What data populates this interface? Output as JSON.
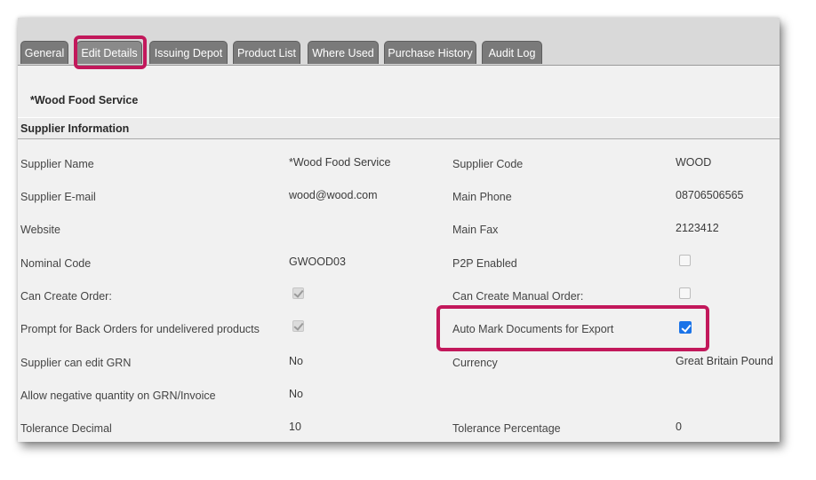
{
  "tabs": [
    {
      "label": "General"
    },
    {
      "label": "Edit Details"
    },
    {
      "label": "Issuing Depot"
    },
    {
      "label": "Product List"
    },
    {
      "label": "Where Used"
    },
    {
      "label": "Purchase History"
    },
    {
      "label": "Audit Log"
    }
  ],
  "active_tab": "Edit Details",
  "company_name": "*Wood Food Service",
  "section_title": "Supplier Information",
  "fields": {
    "supplier_name": {
      "label": "Supplier Name",
      "value": "*Wood Food Service"
    },
    "supplier_code": {
      "label": "Supplier Code",
      "value": "WOOD"
    },
    "supplier_email": {
      "label": "Supplier E-mail",
      "value": "wood@wood.com"
    },
    "main_phone": {
      "label": "Main Phone",
      "value": "08706506565"
    },
    "website": {
      "label": "Website",
      "value": ""
    },
    "main_fax": {
      "label": "Main Fax",
      "value": "2123412"
    },
    "nominal_code": {
      "label": "Nominal Code",
      "value": "GWOOD03"
    },
    "p2p_enabled": {
      "label": "P2P Enabled",
      "checked": false
    },
    "can_create_order": {
      "label": "Can Create Order:",
      "checked": true
    },
    "can_create_manual_order": {
      "label": "Can Create Manual Order:",
      "checked": false
    },
    "prompt_back_orders": {
      "label": "Prompt for Back Orders for undelivered products",
      "checked": true
    },
    "auto_mark_export": {
      "label": "Auto Mark Documents for Export",
      "checked": true
    },
    "supplier_edit_grn": {
      "label": "Supplier can edit GRN",
      "value": "No"
    },
    "currency": {
      "label": "Currency",
      "value": "Great Britain Pound"
    },
    "allow_negative_qty": {
      "label": "Allow negative quantity on GRN/Invoice",
      "value": "No"
    },
    "tolerance_decimal": {
      "label": "Tolerance Decimal",
      "value": "10"
    },
    "tolerance_percentage": {
      "label": "Tolerance Percentage",
      "value": "0"
    }
  },
  "colors": {
    "highlight": "#c2185b",
    "tab_bg": "#7a7a7a",
    "checkbox_checked": "#1a73e8"
  }
}
